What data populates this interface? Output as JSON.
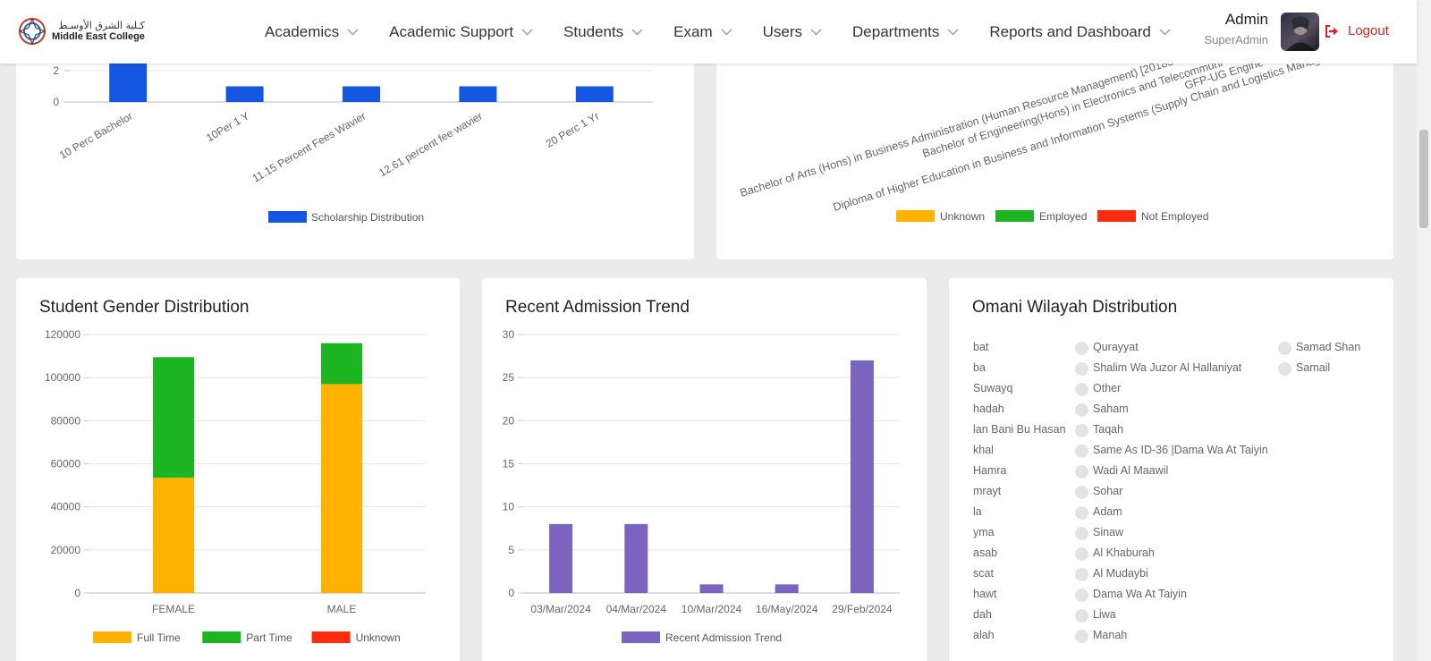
{
  "header": {
    "logo_ar": "كـلية الشرق الأوسـط",
    "logo_en": "Middle East College",
    "nav": [
      "Academics",
      "Academic Support",
      "Students",
      "Exam",
      "Users",
      "Departments",
      "Reports and Dashboard"
    ],
    "user_name": "Admin",
    "user_role": "SuperAdmin",
    "logout_label": "Logout"
  },
  "colors": {
    "blue": "#1456e0",
    "orange": "#ffb300",
    "green": "#1eb523",
    "red": "#ff2b0d",
    "purple": "#7a64bf",
    "logout": "#e02020"
  },
  "icons": {
    "nav_dropdown": "chevron-down-icon",
    "logout": "sign-out-icon"
  },
  "scholarship_card": {
    "legend": "Scholarship Distribution"
  },
  "employment_card": {
    "labels": [
      "Bachelor of Arts (Hons) in Business Administration (Human Resource Management) [20183",
      "Bachelor of Engineering(Hons) in Electronics and Telecommuni",
      "GFP-UG Engine",
      "Diploma of Higher Education in Business and Information Systems (Supply Chain and Logistics Manag"
    ],
    "legend": [
      "Unknown",
      "Employed",
      "Not Employed"
    ]
  },
  "gender_card": {
    "title": "Student Gender Distribution"
  },
  "admission_card": {
    "title": "Recent Admission Trend"
  },
  "wilayah_card": {
    "title": "Omani Wilayah Distribution",
    "col1": [
      "bat",
      "ba",
      "Suwayq",
      "hadah",
      "lan Bani Bu Hasan",
      "khal",
      "Hamra",
      "mrayt",
      "la",
      "yma",
      "asab",
      "scat",
      "hawt",
      "dah",
      "alah"
    ],
    "col2": [
      "Qurayyat",
      "Shalim Wa Juzor Al Hallaniyat",
      "Other",
      "Saham",
      "Taqah",
      "Same As ID-36 |Dama Wa At Taiyin",
      "Wadi Al Maawil",
      "Sohar",
      "Adam",
      "Sinaw",
      "Al Khaburah",
      "Al Mudaybi",
      "Dama Wa At Taiyin",
      "Liwa",
      "Manah"
    ],
    "col3": [
      "Samad Shan",
      "Samail"
    ]
  },
  "chart_data": [
    {
      "type": "bar",
      "title": "",
      "categories": [
        "10 Perc Bachelor",
        "10Per 1 Y",
        "11.15 Percent Fees Wavier",
        "12.61 percent fee wavier",
        "20 Perc 1 Yr"
      ],
      "series": [
        {
          "name": "Scholarship Distribution",
          "values": [
            3,
            1,
            1,
            1,
            1
          ]
        }
      ],
      "y_ticks": [
        0,
        2
      ],
      "legend": "bottom"
    },
    {
      "type": "bar",
      "stacked": true,
      "title": "Student Gender Distribution",
      "categories": [
        "FEMALE",
        "MALE"
      ],
      "series": [
        {
          "name": "Full Time",
          "values": [
            53500,
            97000
          ]
        },
        {
          "name": "Part Time",
          "values": [
            56000,
            19000
          ]
        },
        {
          "name": "Unknown",
          "values": [
            0,
            0
          ]
        }
      ],
      "ylim": [
        0,
        120000
      ],
      "y_ticks": [
        0,
        20000,
        40000,
        60000,
        80000,
        100000,
        120000
      ],
      "grid": true,
      "legend": "bottom"
    },
    {
      "type": "bar",
      "title": "Recent Admission Trend",
      "categories": [
        "03/Mar/2024",
        "04/Mar/2024",
        "10/Mar/2024",
        "16/May/2024",
        "29/Feb/2024"
      ],
      "series": [
        {
          "name": "Recent Admission Trend",
          "values": [
            8,
            8,
            1,
            1,
            27
          ]
        }
      ],
      "ylim": [
        0,
        30
      ],
      "y_ticks": [
        0,
        5,
        10,
        15,
        20,
        25,
        30
      ],
      "grid": true,
      "legend": "bottom"
    }
  ]
}
